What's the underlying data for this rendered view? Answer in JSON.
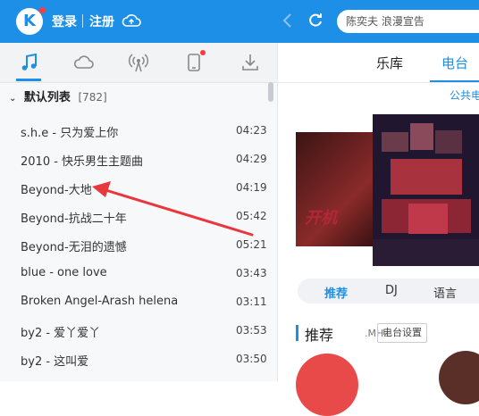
{
  "header": {
    "login": "登录",
    "register": "注册",
    "search_text": "陈奕夫 浪漫宣告"
  },
  "left_tabs": [
    "music-note-icon",
    "cloud-icon",
    "radio-icon",
    "phone-icon",
    "download-icon"
  ],
  "playlist": {
    "name": "默认列表",
    "count": "[782]",
    "songs": [
      {
        "title": "s.h.e - 只为爱上你",
        "duration": "04:23"
      },
      {
        "title": "2010 - 快乐男生主题曲",
        "duration": "04:29"
      },
      {
        "title": "Beyond-大地",
        "duration": "04:19"
      },
      {
        "title": "Beyond-抗战二十年",
        "duration": "05:42"
      },
      {
        "title": "Beyond-无泪的遗憾",
        "duration": "05:21"
      },
      {
        "title": "blue - one love",
        "duration": "03:43"
      },
      {
        "title": "Broken Angel-Arash helena",
        "duration": "03:11"
      },
      {
        "title": "by2 - 爱丫爱丫",
        "duration": "03:53"
      },
      {
        "title": "by2 - 这叫爱",
        "duration": "03:50"
      }
    ]
  },
  "right": {
    "tabs": [
      "乐库",
      "电台"
    ],
    "public_link": "公共电",
    "subtabs": [
      "推荐",
      "DJ",
      "语言"
    ],
    "section_title": "推荐",
    "section_unit": ".MHz",
    "section_button": "电台设置"
  },
  "colors": {
    "accent": "#1e8fe6",
    "arrow": "#e8383d"
  }
}
